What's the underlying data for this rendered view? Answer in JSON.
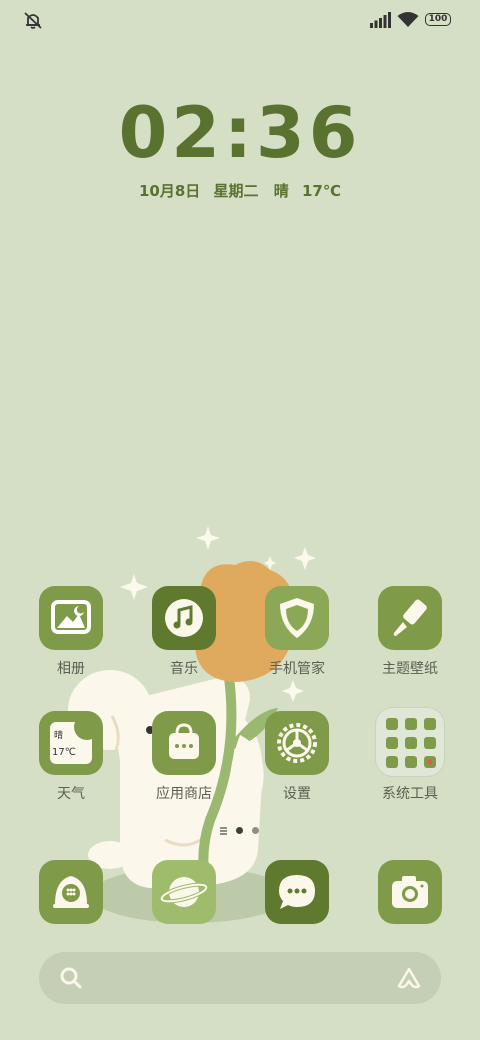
{
  "status_bar": {
    "left_icon": "muted-notification-icon",
    "signal_icon": "signal-bars-icon",
    "wifi_icon": "wifi-icon",
    "battery_value": "100"
  },
  "clock": {
    "time": "02:36",
    "date": "10月8日",
    "weekday": "星期二",
    "weather": "晴",
    "temp": "17℃"
  },
  "apps_row1": [
    {
      "label": "相册",
      "icon": "gallery-icon"
    },
    {
      "label": "音乐",
      "icon": "music-icon"
    },
    {
      "label": "手机管家",
      "icon": "security-shield-icon"
    },
    {
      "label": "主题壁纸",
      "icon": "theme-brush-icon"
    }
  ],
  "apps_row2": [
    {
      "label": "天气",
      "icon": "weather-icon",
      "mini_text": "晴",
      "mini_temp": "17℃"
    },
    {
      "label": "应用商店",
      "icon": "app-store-bag-icon"
    },
    {
      "label": "设置",
      "icon": "settings-gear-icon"
    },
    {
      "label": "系统工具",
      "icon": "system-tools-folder-icon"
    }
  ],
  "page_indicator": {
    "current": 1,
    "total": 2
  },
  "dock": [
    {
      "icon": "phone-icon"
    },
    {
      "icon": "browser-planet-icon"
    },
    {
      "icon": "messages-icon"
    },
    {
      "icon": "camera-icon"
    }
  ],
  "search_bar": {
    "icon": "search-icon",
    "assistant_icon": "assistant-icon"
  },
  "colors": {
    "background": "#d5dfc6",
    "accent_dark": "#5a7230",
    "icon_green": "#7f9a48",
    "icon_dark": "#5f7a2e",
    "flower": "#e0aa5e"
  }
}
